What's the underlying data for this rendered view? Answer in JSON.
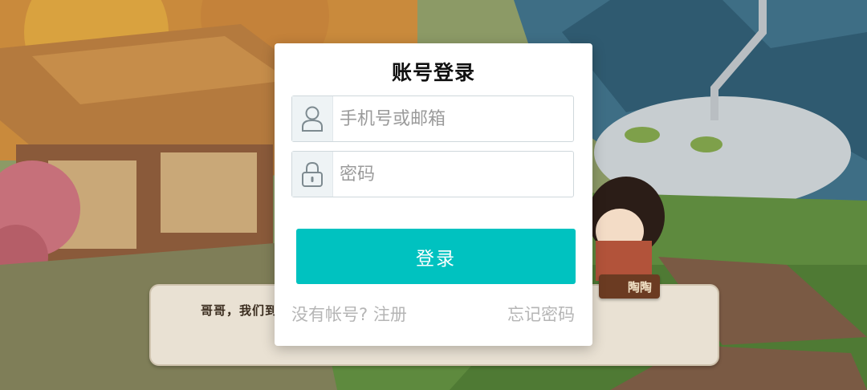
{
  "modal": {
    "title": "账号登录",
    "username": {
      "placeholder": "手机号或邮箱",
      "value": "",
      "icon": "user-icon"
    },
    "password": {
      "placeholder": "密码",
      "value": "",
      "icon": "lock-icon"
    },
    "login_label": "登录",
    "register_link": "没有帐号? 注册",
    "forgot_link": "忘记密码"
  },
  "scene": {
    "dialogue_text": "哥哥，我们到",
    "speaker_name": "陶陶"
  },
  "colors": {
    "accent": "#00c2c0",
    "link_gray": "#b5b5b5",
    "modal_bg": "#ffffff"
  }
}
